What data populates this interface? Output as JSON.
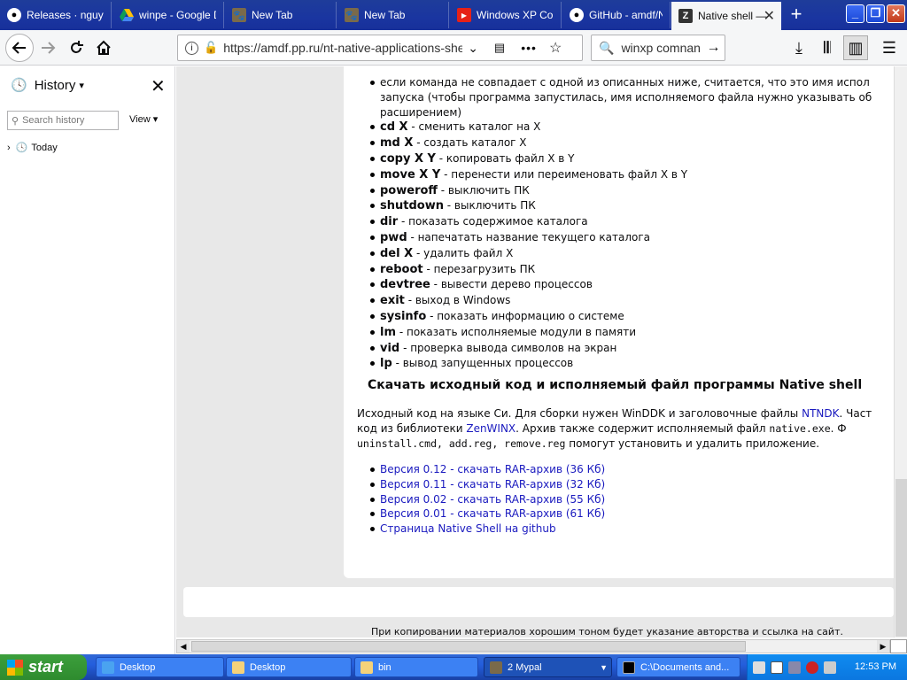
{
  "tabs": [
    {
      "label": "Releases · nguye",
      "icon": "github-icon"
    },
    {
      "label": "winpe - Google D",
      "icon": "google-drive-icon"
    },
    {
      "label": "New Tab",
      "icon": "firefox-icon"
    },
    {
      "label": "New Tab",
      "icon": "firefox-icon"
    },
    {
      "label": "Windows XP Com",
      "icon": "youtube-icon"
    },
    {
      "label": "GitHub - amdf/Na",
      "icon": "github-icon"
    },
    {
      "label": "Native shell —",
      "icon": "site-favicon",
      "active": true
    }
  ],
  "toolbar": {
    "url": "https://amdf.pp.ru/nt-native-applications-shell.pl",
    "search_value": "winxp comnand-"
  },
  "sidebar": {
    "title": "History",
    "search_placeholder": "Search history",
    "view_label": "View",
    "today_label": "Today"
  },
  "content": {
    "commands": [
      {
        "cmd": "",
        "desc": "если команда не совпадает с одной из описанных ниже, считается, что это имя испол",
        "cont": [
          "запуска (чтобы программа запустилась, имя исполняемого файла нужно указывать об",
          "расширением)"
        ]
      },
      {
        "cmd": "cd X",
        "desc": " - сменить каталог на X"
      },
      {
        "cmd": "md X",
        "desc": " - создать каталог X"
      },
      {
        "cmd": "copy X Y",
        "desc": " - копировать файл X в Y"
      },
      {
        "cmd": "move X Y",
        "desc": " - перенести или переименовать файл X в Y"
      },
      {
        "cmd": "poweroff",
        "desc": " - выключить ПК"
      },
      {
        "cmd": "shutdown",
        "desc": " - выключить ПК"
      },
      {
        "cmd": "dir",
        "desc": " - показать содержимое каталога"
      },
      {
        "cmd": "pwd",
        "desc": " - напечатать название текущего каталога"
      },
      {
        "cmd": "del X",
        "desc": " - удалить файл X"
      },
      {
        "cmd": "reboot",
        "desc": " - перезагрузить ПК"
      },
      {
        "cmd": "devtree",
        "desc": " - вывести дерево процессов"
      },
      {
        "cmd": "exit",
        "desc": " - выход в Windows"
      },
      {
        "cmd": "sysinfo",
        "desc": " - показать информацию о системе"
      },
      {
        "cmd": "lm",
        "desc": " - показать исполняемые модули в памяти"
      },
      {
        "cmd": "vid",
        "desc": " - проверка вывода символов на экран"
      },
      {
        "cmd": "lp",
        "desc": " - вывод запущенных процессов"
      }
    ],
    "download_heading": "Скачать исходный код и исполняемый файл программы Native shell",
    "para": {
      "t1": "Исходный код на языке Си. Для сборки нужен WinDDK и заголовочные файлы ",
      "link1": "NTNDK",
      "t2": ". Част",
      "t3": "код из библиотеки ",
      "link2": "ZenWINX",
      "t4": ". Архив также содержит исполняемый файл ",
      "file1": "native.exe",
      "t5": ". Ф",
      "files2": "uninstall.cmd, add.reg, remove.reg",
      "t6": " помогут установить и удалить приложение."
    },
    "downloads": [
      "Версия 0.12 - скачать RAR-архив (36 Кб)",
      "Версия 0.11 - скачать RAR-архив (32 Кб)",
      "Версия 0.02 - скачать RAR-архив (55 Кб)",
      "Версия 0.01 - скачать RAR-архив (61 Кб)",
      "Страница Native Shell на github"
    ],
    "footer": "При копировании материалов хорошим тоном будет указание авторства и ссылка на сайт."
  },
  "taskbar": {
    "start": "start",
    "tasks": [
      {
        "label": "Desktop",
        "icon": "ie-icon"
      },
      {
        "label": "Desktop",
        "icon": "folder-icon"
      },
      {
        "label": "bin",
        "icon": "folder-icon"
      },
      {
        "label": "2 Mypal",
        "icon": "mypal-icon",
        "active": true
      },
      {
        "label": "C:\\Documents and...",
        "icon": "cmd-icon"
      }
    ],
    "clock": "12:53 PM"
  },
  "colors": {
    "link": "#1a1abf",
    "tabbar": "#1a35a0",
    "taskbar": "#245edc",
    "start": "#2e8b2e"
  }
}
